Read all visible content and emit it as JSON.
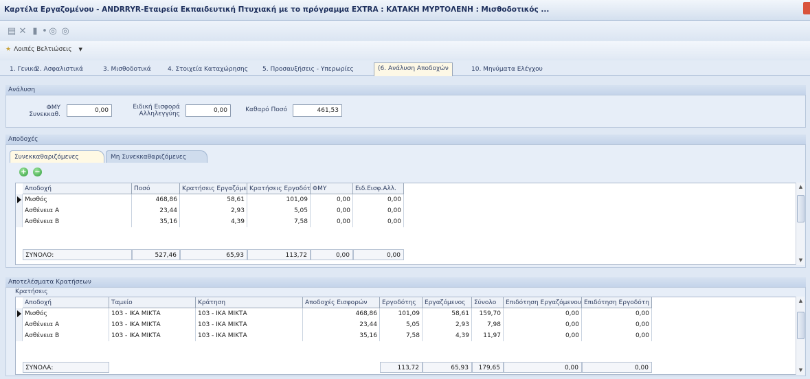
{
  "window": {
    "title": "Καρτέλα Εργαζομένου - ANDRRYR-Εταιρεία Εκπαιδευτική Πτυχιακή με το πρόγραμμα EXTRA : ΚΑΤΑΚΗ ΜΥΡΤΟΛΕΝΗ : Μισθοδοτικός ..."
  },
  "toolbar": {
    "icons": [
      "save-icon",
      "delete-icon",
      "copy-icon",
      "options-icon",
      "back-icon",
      "forward-icon"
    ]
  },
  "actions": {
    "label": "Λοιπές Βελτιώσεις"
  },
  "tabs": [
    {
      "label": "1. Γενικά"
    },
    {
      "label": "2. Ασφαλιστικά"
    },
    {
      "label": "3. Μισθοδοτικά"
    },
    {
      "label": "4. Στοιχεία Καταχώρησης"
    },
    {
      "label": "5. Προσαυξήσεις - Υπερωρίες"
    },
    {
      "label": "(6. Ανάλυση Αποδοχών"
    },
    {
      "label": "10. Μηνύματα Ελέγχου"
    }
  ],
  "analysis": {
    "header": "Ανάλυση",
    "fmy_label": "ΦΜΥ Συνεκκαθ.",
    "fmy_value": "0,00",
    "eidiki_label": "Ειδική Εισφορά Αλληλεγγύης",
    "eidiki_value": "0,00",
    "net_label": "Καθαρό Ποσό",
    "net_value": "461,53"
  },
  "earnings": {
    "header": "Αποδοχές",
    "subtabs": [
      "Συνεκκαθαριζόμενες",
      "Μη Συνεκκαθαριζόμενες"
    ],
    "columns": [
      "Αποδοχή",
      "Ποσό",
      "Κρατήσεις Εργαζόμενου",
      "Κρατήσεις Εργοδότη",
      "ΦΜΥ",
      "Ειδ.Εισφ.Αλλ."
    ],
    "rows": [
      [
        "Μισθός",
        "468,86",
        "58,61",
        "101,09",
        "0,00",
        "0,00"
      ],
      [
        "Ασθένεια Α",
        "23,44",
        "2,93",
        "5,05",
        "0,00",
        "0,00"
      ],
      [
        "Ασθένεια Β",
        "35,16",
        "4,39",
        "7,58",
        "0,00",
        "0,00"
      ]
    ],
    "total": [
      "ΣΥΝΟΛΟ:",
      "527,46",
      "65,93",
      "113,72",
      "0,00",
      "0,00"
    ]
  },
  "deductions": {
    "header": "Αποτελέσματα Κρατήσεων",
    "subheader": "Κρατήσεις",
    "columns": [
      "Αποδοχή",
      "Ταμείο",
      "Κράτηση",
      "Αποδοχές Εισφορών",
      "Εργοδότης",
      "Εργαζόμενος",
      "Σύνολο",
      "Επιδότηση Εργαζόμενου",
      "Επιδότηση Εργοδότη"
    ],
    "rows": [
      [
        "Μισθός",
        "103 - ΙΚΑ ΜΙΚΤΑ",
        "103 - ΙΚΑ ΜΙΚΤΑ",
        "468,86",
        "101,09",
        "58,61",
        "159,70",
        "0,00",
        "0,00"
      ],
      [
        "Ασθένεια Α",
        "103 - ΙΚΑ ΜΙΚΤΑ",
        "103 - ΙΚΑ ΜΙΚΤΑ",
        "23,44",
        "5,05",
        "2,93",
        "7,98",
        "0,00",
        "0,00"
      ],
      [
        "Ασθένεια Β",
        "103 - ΙΚΑ ΜΙΚΤΑ",
        "103 - ΙΚΑ ΜΙΚΤΑ",
        "35,16",
        "7,58",
        "4,39",
        "11,97",
        "0,00",
        "0,00"
      ]
    ],
    "total": {
      "label": "ΣΥΝΟΛΑ:",
      "employer": "113,72",
      "employee": "65,93",
      "sum": "179,65",
      "sub_employee": "0,00",
      "sub_employer": "0,00"
    }
  }
}
